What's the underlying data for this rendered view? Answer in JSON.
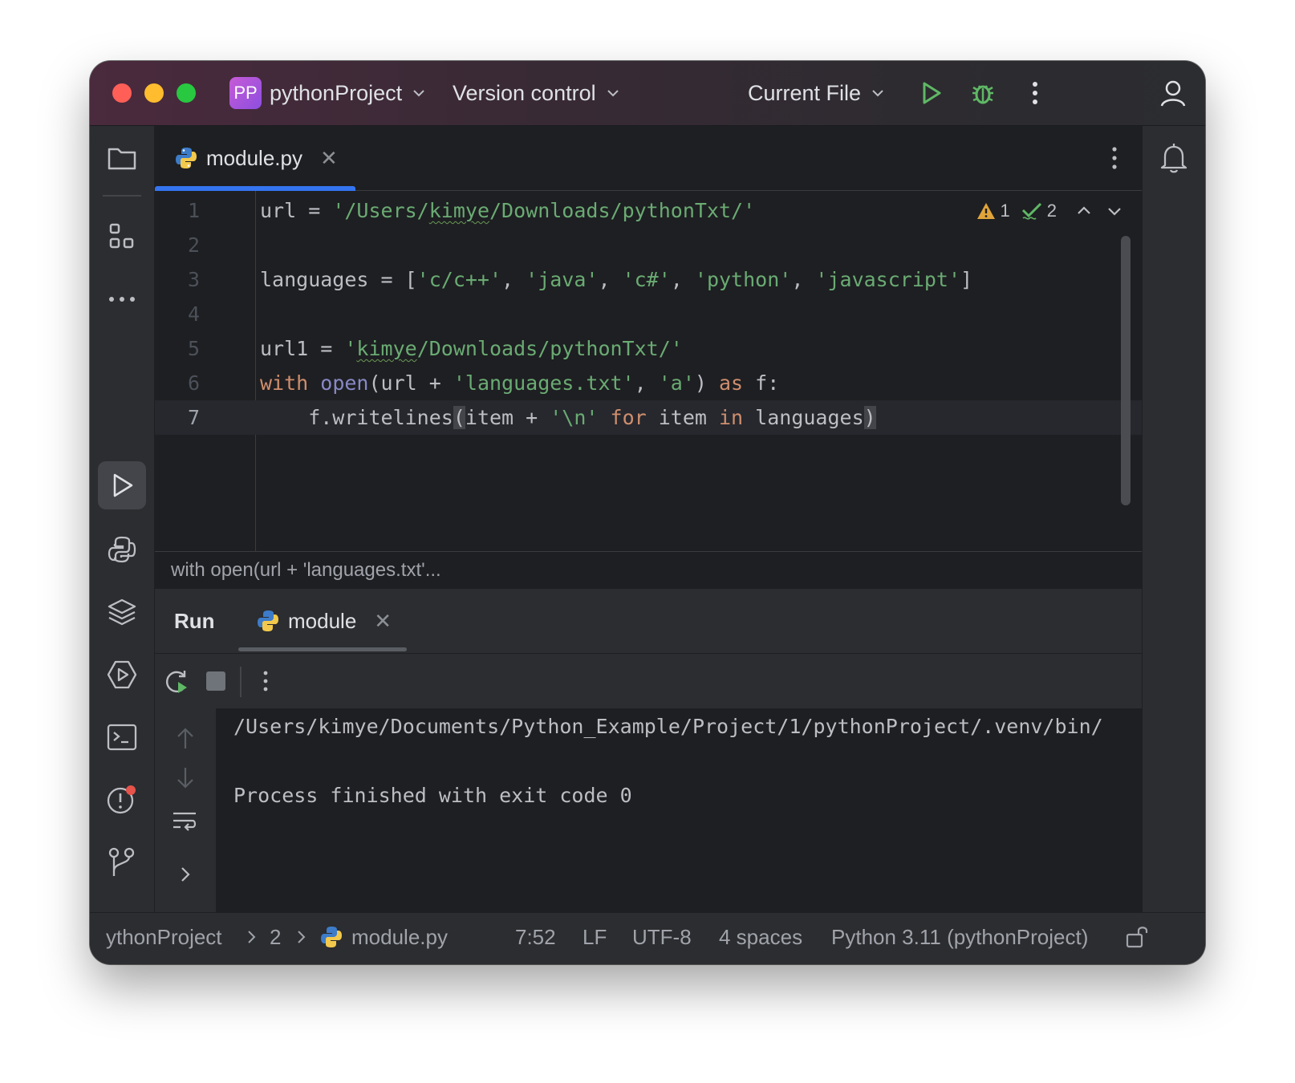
{
  "title_bar": {
    "project_badge": "PP",
    "project_name": "pythonProject",
    "vcs_label": "Version control",
    "run_config": "Current File"
  },
  "editor": {
    "tab_label": "module.py",
    "inspections": {
      "warnings": "1",
      "weak_warnings": "2"
    },
    "lines": [
      {
        "num": "1",
        "parts": [
          [
            "p",
            "url = "
          ],
          [
            "s",
            "'/Users/"
          ],
          [
            "sw",
            "kimye"
          ],
          [
            "s",
            "/Downloads/pythonTxt/'"
          ]
        ]
      },
      {
        "num": "2",
        "parts": []
      },
      {
        "num": "3",
        "parts": [
          [
            "p",
            "languages = ["
          ],
          [
            "s",
            "'c/c++'"
          ],
          [
            "p",
            ", "
          ],
          [
            "s",
            "'java'"
          ],
          [
            "p",
            ", "
          ],
          [
            "s",
            "'c#'"
          ],
          [
            "p",
            ", "
          ],
          [
            "s",
            "'python'"
          ],
          [
            "p",
            ", "
          ],
          [
            "s",
            "'javascript'"
          ],
          [
            "p",
            "]"
          ]
        ]
      },
      {
        "num": "4",
        "parts": []
      },
      {
        "num": "5",
        "parts": [
          [
            "p",
            "url1 = "
          ],
          [
            "s",
            "'"
          ],
          [
            "sw",
            "kimye"
          ],
          [
            "s",
            "/Downloads/pythonTxt/'"
          ]
        ]
      },
      {
        "num": "6",
        "parts": [
          [
            "k",
            "with "
          ],
          [
            "b",
            "open"
          ],
          [
            "p",
            "(url + "
          ],
          [
            "s",
            "'languages.txt'"
          ],
          [
            "p",
            ", "
          ],
          [
            "s",
            "'a'"
          ],
          [
            "p",
            ") "
          ],
          [
            "k",
            "as"
          ],
          [
            "p",
            " f:"
          ]
        ]
      },
      {
        "num": "7",
        "current": true,
        "parts": [
          [
            "p",
            "    f.writelines"
          ],
          [
            "br",
            "("
          ],
          [
            "p",
            "item + "
          ],
          [
            "s",
            "'\\n'"
          ],
          [
            "p",
            " "
          ],
          [
            "k",
            "for"
          ],
          [
            "p",
            " item "
          ],
          [
            "k",
            "in"
          ],
          [
            "p",
            " languages"
          ],
          [
            "br",
            ")"
          ]
        ]
      }
    ],
    "breadcrumb": "with open(url + 'languages.txt'..."
  },
  "run_panel": {
    "title": "Run",
    "tab_label": "module",
    "output_lines": [
      "/Users/kimye/Documents/Python_Example/Project/1/pythonProject/.venv/bin/",
      "",
      "Process finished with exit code 0"
    ]
  },
  "status_bar": {
    "project": "ythonProject",
    "folder": "2",
    "file": "module.py",
    "position": "7:52",
    "line_ending": "LF",
    "encoding": "UTF-8",
    "indent": "4 spaces",
    "interpreter": "Python 3.11 (pythonProject)"
  },
  "colors": {
    "accent": "#3574f0",
    "string": "#6aab73",
    "keyword": "#cf8e6d",
    "builtin": "#8888c6",
    "run_green": "#5fb865"
  }
}
